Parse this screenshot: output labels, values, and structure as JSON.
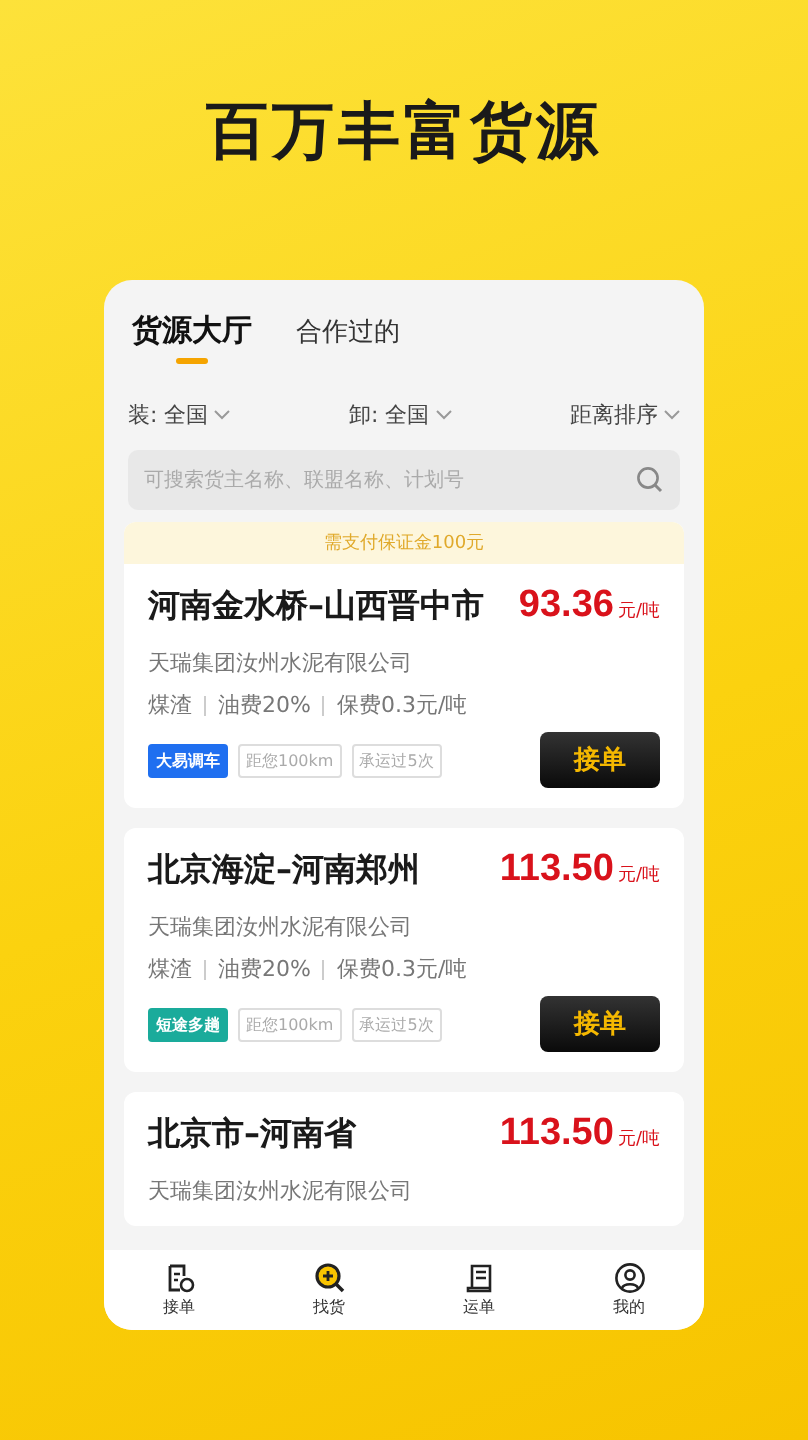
{
  "headline": "百万丰富货源",
  "tabs": [
    {
      "label": "货源大厅",
      "selected": true
    },
    {
      "label": "合作过的",
      "selected": false
    }
  ],
  "filters": [
    {
      "label": "装: 全国"
    },
    {
      "label": "卸: 全国"
    },
    {
      "label": "距离排序"
    }
  ],
  "search": {
    "placeholder": "可搜索货主名称、联盟名称、计划号"
  },
  "orders": [
    {
      "notice": "需支付保证金100元",
      "route": "河南金水桥–山西晋中市",
      "price": "93.36",
      "unit": "元/吨",
      "company": "天瑞集团汝州水泥有限公司",
      "details": [
        "煤渣",
        "油费20%",
        "保费0.3元/吨"
      ],
      "tags": [
        {
          "label": "大易调车",
          "color": "#1f6ff0"
        },
        {
          "label": "距您100km"
        },
        {
          "label": "承运过5次"
        }
      ],
      "button": "接单"
    },
    {
      "route": "北京海淀–河南郑州",
      "price": "113.50",
      "unit": "元/吨",
      "company": "天瑞集团汝州水泥有限公司",
      "details": [
        "煤渣",
        "油费20%",
        "保费0.3元/吨"
      ],
      "tags": [
        {
          "label": "短途多趟",
          "color": "#1aab9b"
        },
        {
          "label": "距您100km"
        },
        {
          "label": "承运过5次"
        }
      ],
      "button": "接单"
    },
    {
      "route": "北京市–河南省",
      "price": "113.50",
      "unit": "元/吨",
      "company": "天瑞集团汝州水泥有限公司"
    }
  ],
  "nav": [
    {
      "label": "接单",
      "kind": "orders",
      "selected": false
    },
    {
      "label": "找货",
      "kind": "find",
      "selected": true
    },
    {
      "label": "运单",
      "kind": "waybill",
      "selected": false
    },
    {
      "label": "我的",
      "kind": "profile",
      "selected": false
    }
  ]
}
